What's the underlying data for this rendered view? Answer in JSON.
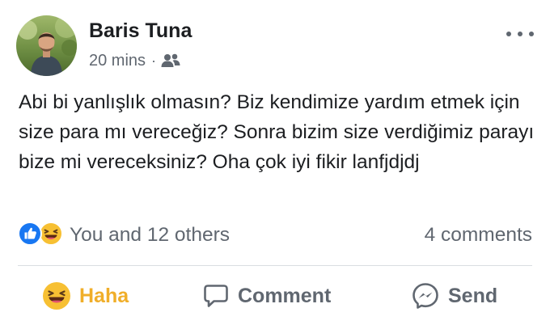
{
  "post": {
    "author": "Baris Tuna",
    "time": "20 mins",
    "separator": "·",
    "audience_icon": "friends-icon",
    "more_icon": "more-options-icon",
    "text": "Abi bi yanlışlık olmasın? Biz kendimize yardım etmek için size para mı vereceğiz? Sonra bizim size verdiğimiz parayı bize mi vereceksiniz? Oha çok iyi fikir lanfjdjdj"
  },
  "reactions": {
    "icons": [
      "like-icon",
      "haha-icon"
    ],
    "summary": "You and 12 others",
    "comments": "4 comments"
  },
  "actions": {
    "haha_label": "Haha",
    "comment_label": "Comment",
    "send_label": "Send"
  },
  "colors": {
    "like_blue": "#1877f2",
    "haha_yellow": "#f0ae29",
    "secondary_text": "#606770",
    "primary_text": "#1c1e21",
    "divider": "#dadde1"
  }
}
